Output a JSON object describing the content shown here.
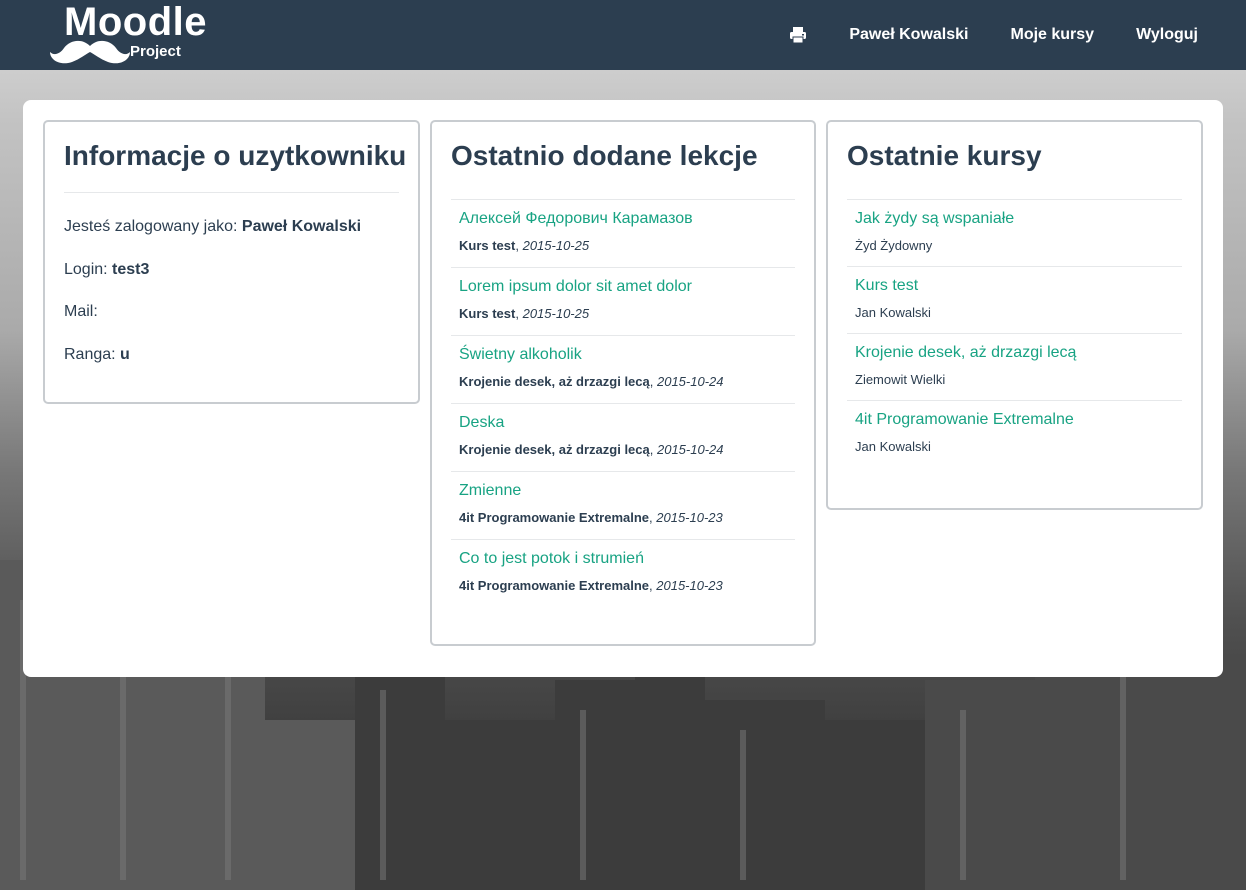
{
  "brand": {
    "name": "Moodle",
    "subtitle": "Project"
  },
  "nav": {
    "print_icon": "printer-icon",
    "user": "Paweł Kowalski",
    "my_courses": "Moje kursy",
    "logout": "Wyloguj"
  },
  "colors": {
    "navbar": "#2c3e50",
    "link": "#18a383",
    "text": "#2c3e50"
  },
  "user_info": {
    "title": "Informacje o uzytkowniku",
    "logged_as_label": "Jesteś zalogowany jako:",
    "logged_as_value": "Paweł Kowalski",
    "login_label": "Login:",
    "login_value": "test3",
    "mail_label": "Mail:",
    "mail_value": "",
    "rank_label": "Ranga:",
    "rank_value": "u"
  },
  "lessons": {
    "title": "Ostatnio dodane lekcje",
    "items": [
      {
        "name": "Алексей Федорович Карамазов",
        "course": "Kurs test",
        "date": "2015-10-25"
      },
      {
        "name": "Lorem ipsum dolor sit amet dolor",
        "course": "Kurs test",
        "date": "2015-10-25"
      },
      {
        "name": "Świetny alkoholik",
        "course": "Krojenie desek, aż drzazgi lecą",
        "date": "2015-10-24"
      },
      {
        "name": "Deska",
        "course": "Krojenie desek, aż drzazgi lecą",
        "date": "2015-10-24"
      },
      {
        "name": "Zmienne",
        "course": "4it Programowanie Extremalne",
        "date": "2015-10-23"
      },
      {
        "name": "Co to jest potok i strumień",
        "course": "4it Programowanie Extremalne",
        "date": "2015-10-23"
      }
    ]
  },
  "courses": {
    "title": "Ostatnie kursy",
    "items": [
      {
        "name": "Jak żydy są wspaniałe",
        "author": "Żyd Żydowny"
      },
      {
        "name": "Kurs test",
        "author": "Jan Kowalski"
      },
      {
        "name": "Krojenie desek, aż drzazgi lecą",
        "author": "Ziemowit Wielki"
      },
      {
        "name": "4it Programowanie Extremalne",
        "author": "Jan Kowalski"
      }
    ]
  }
}
